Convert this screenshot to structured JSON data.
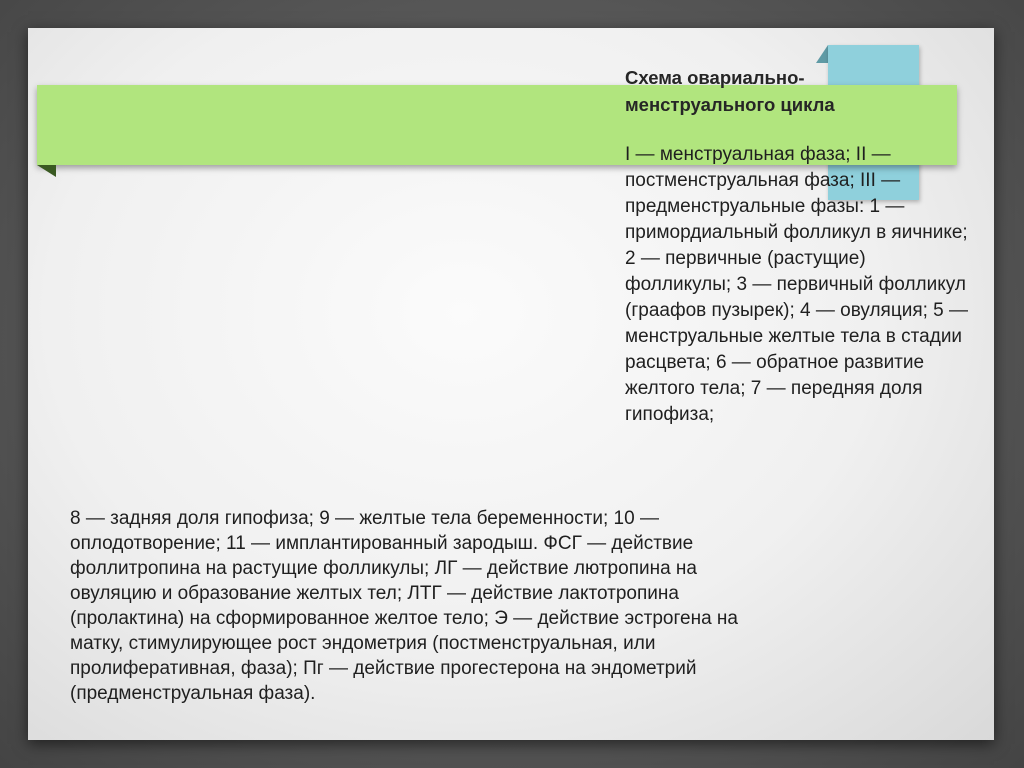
{
  "slide": {
    "title": "Схема овариально-\nменструального цикла",
    "caption": "I — менструальная фаза; II — постменструальная фаза; III — предменструальные фазы: 1 — примордиальный фолликул в яичнике; 2 — первичные (растущие) фолликулы; 3 — первичный фолликул (граафов пузырек); 4 — овуляция; 5 — менструальные желтые тела в стадии расцвета; 6 — обратное развитие желтого тела; 7 — передняя доля гипофиза;",
    "body": " 8 — задняя доля гипофиза; 9 — желтые тела беременности; 10 —\nоплодотворение; 11 — имплантированный зародыш. ФСГ — действие\nфоллитропина на растущие фолликулы; ЛГ — действие лютропина на\nовуляцию и образование желтых тел; ЛТГ — действие лактотропина\n(пролактина) на сформированное желтое тело; Э — действие эстрогена на\nматку, стимулирующее рост эндометрия (постменструальная, или\nпролиферативная, фаза); Пг — действие прогестерона на эндометрий\n(предменструальная фаза)."
  },
  "colors": {
    "accent_green": "#b1e57e",
    "accent_cyan": "#8fd0dc",
    "background": "#5a5a5a"
  }
}
